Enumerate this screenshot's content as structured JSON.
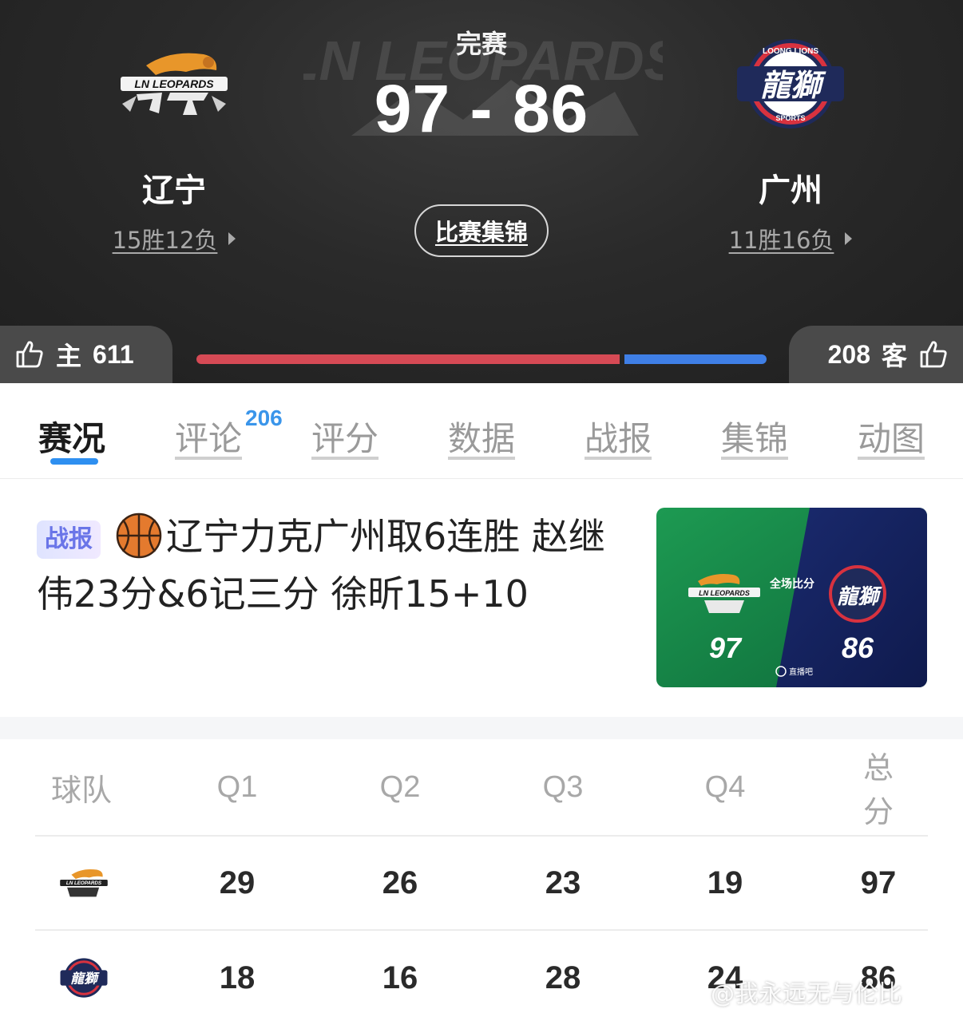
{
  "header": {
    "status": "完赛",
    "score": "97 - 86",
    "home": {
      "name": "辽宁",
      "record": "15胜12负",
      "logo_text": "LN LEOPARDS"
    },
    "away": {
      "name": "广州",
      "record": "11胜16负",
      "logo_text": "龍獅"
    },
    "highlights_label": "比赛集锦"
  },
  "votes": {
    "home_label": "主",
    "home_count": "611",
    "away_label": "客",
    "away_count": "208",
    "home_fraction": 0.746,
    "home_color": "#d64a55",
    "away_color": "#3f7fe6"
  },
  "tabs": [
    {
      "label": "赛况",
      "active": true
    },
    {
      "label": "评论",
      "badge": "206"
    },
    {
      "label": "评分"
    },
    {
      "label": "数据"
    },
    {
      "label": "战报"
    },
    {
      "label": "集锦"
    },
    {
      "label": "动图"
    }
  ],
  "news": {
    "tag": "战报",
    "title": "辽宁力克广州取6连胜 赵继伟23分&6记三分 徐昕15+10",
    "thumb": {
      "caption": "全场比分",
      "home_score": "97",
      "away_score": "86",
      "source": "直播吧"
    }
  },
  "scoreboard": {
    "headers": [
      "球队",
      "Q1",
      "Q2",
      "Q3",
      "Q4",
      "总分"
    ],
    "rows": [
      {
        "team": "辽宁",
        "scores": [
          "29",
          "26",
          "23",
          "19",
          "97"
        ]
      },
      {
        "team": "广州",
        "scores": [
          "18",
          "16",
          "28",
          "24",
          "86"
        ]
      }
    ]
  },
  "watermark": "@我永远无与伦比",
  "colors": {
    "accent": "#2e8ff0",
    "badge": "#3a95ea"
  }
}
